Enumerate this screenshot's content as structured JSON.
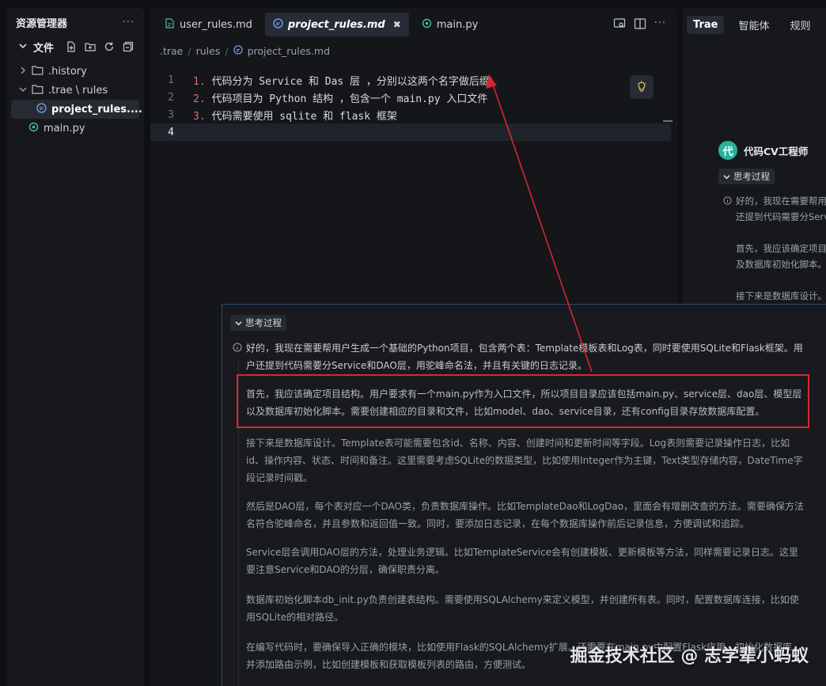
{
  "explorer": {
    "title": "资源管理器",
    "more": "···",
    "section_label": "文件",
    "tree": [
      {
        "label": ".history",
        "type": "folder",
        "expanded": false
      },
      {
        "label": ".trae \\ rules",
        "type": "folder",
        "expanded": true
      },
      {
        "label": "project_rules....",
        "type": "md",
        "selected": true
      },
      {
        "label": "main.py",
        "type": "py"
      }
    ]
  },
  "editor": {
    "tabs": [
      {
        "label": "user_rules.md",
        "icon": "rules-file-icon"
      },
      {
        "label": "project_rules.md",
        "icon": "md-file-icon",
        "active": true,
        "close": "✖"
      },
      {
        "label": "main.py",
        "icon": "python-file-icon"
      }
    ],
    "more": "···",
    "breadcrumb": [
      ".trae",
      "rules",
      "project_rules.md"
    ],
    "lines": [
      {
        "num": "1",
        "marker": "1.",
        "text": " 代码分为 Service 和 Das 层 ，分别以这两个名字做后缀"
      },
      {
        "num": "2",
        "marker": "2.",
        "text": " 代码项目为 Python 结构 ，包含一个 main.py 入口文件"
      },
      {
        "num": "3",
        "marker": "3.",
        "text": " 代码需要使用 sqlite 和 flask 框架"
      },
      {
        "num": "4",
        "marker": "",
        "text": ""
      }
    ]
  },
  "chat": {
    "tabs": [
      "Trae",
      "智能体",
      "规则"
    ],
    "agent_avatar": "代",
    "agent_name": "代码CV工程师",
    "thinking_label": "思考过程",
    "snippets": [
      "好的，我现在需要帮用户生成一个基础的",
      "还提到代码需要分Service和DAO层",
      "首先，我应该确定项目结构。",
      "及数据库初始化脚本。",
      "接下来是数据库设计。"
    ]
  },
  "popup": {
    "thinking_label": "思考过程",
    "paragraphs": [
      "好的，我现在需要帮用户生成一个基础的Python项目，包含两个表：Template模板表和Log表，同时要使用SQLite和Flask框架。用户还提到代码需要分Service和DAO层，用驼峰命名法，并且有关键的日志记录。",
      "首先，我应该确定项目结构。用户要求有一个main.py作为入口文件，所以项目目录应该包括main.py、service层、dao层、模型层以及数据库初始化脚本。需要创建相应的目录和文件，比如model、dao、service目录，还有config目录存放数据库配置。",
      "接下来是数据库设计。Template表可能需要包含id、名称、内容、创建时间和更新时间等字段。Log表则需要记录操作日志，比如id、操作内容、状态、时间和备注。这里需要考虑SQLite的数据类型，比如使用Integer作为主键，Text类型存储内容，DateTime字段记录时间戳。",
      "然后是DAO层，每个表对应一个DAO类，负责数据库操作。比如TemplateDao和LogDao，里面会有增删改查的方法。需要确保方法名符合驼峰命名，并且参数和返回值一致。同时，要添加日志记录，在每个数据库操作前后记录信息，方便调试和追踪。",
      "Service层会调用DAO层的方法，处理业务逻辑。比如TemplateService会有创建模板、更新模板等方法，同样需要记录日志。这里要注意Service和DAO的分层，确保职责分离。",
      "数据库初始化脚本db_init.py负责创建表结构。需要使用SQLAlchemy来定义模型，并创建所有表。同时，配置数据库连接，比如使用SQLite的相对路径。",
      "在编写代码时，要确保导入正确的模块，比如使用Flask的SQLAlchemy扩展。还需要在main.py中配置Flask应用，初始化数据库，并添加路由示例，比如创建模板和获取模板列表的路由，方便测试。"
    ],
    "watermark": "掘金技术社区 @ 志学辈小蚂蚁"
  },
  "colors": {
    "highlight_box": "#e0262a",
    "annotation_arrow": "#d8262a",
    "avatar": "#27b39b"
  }
}
